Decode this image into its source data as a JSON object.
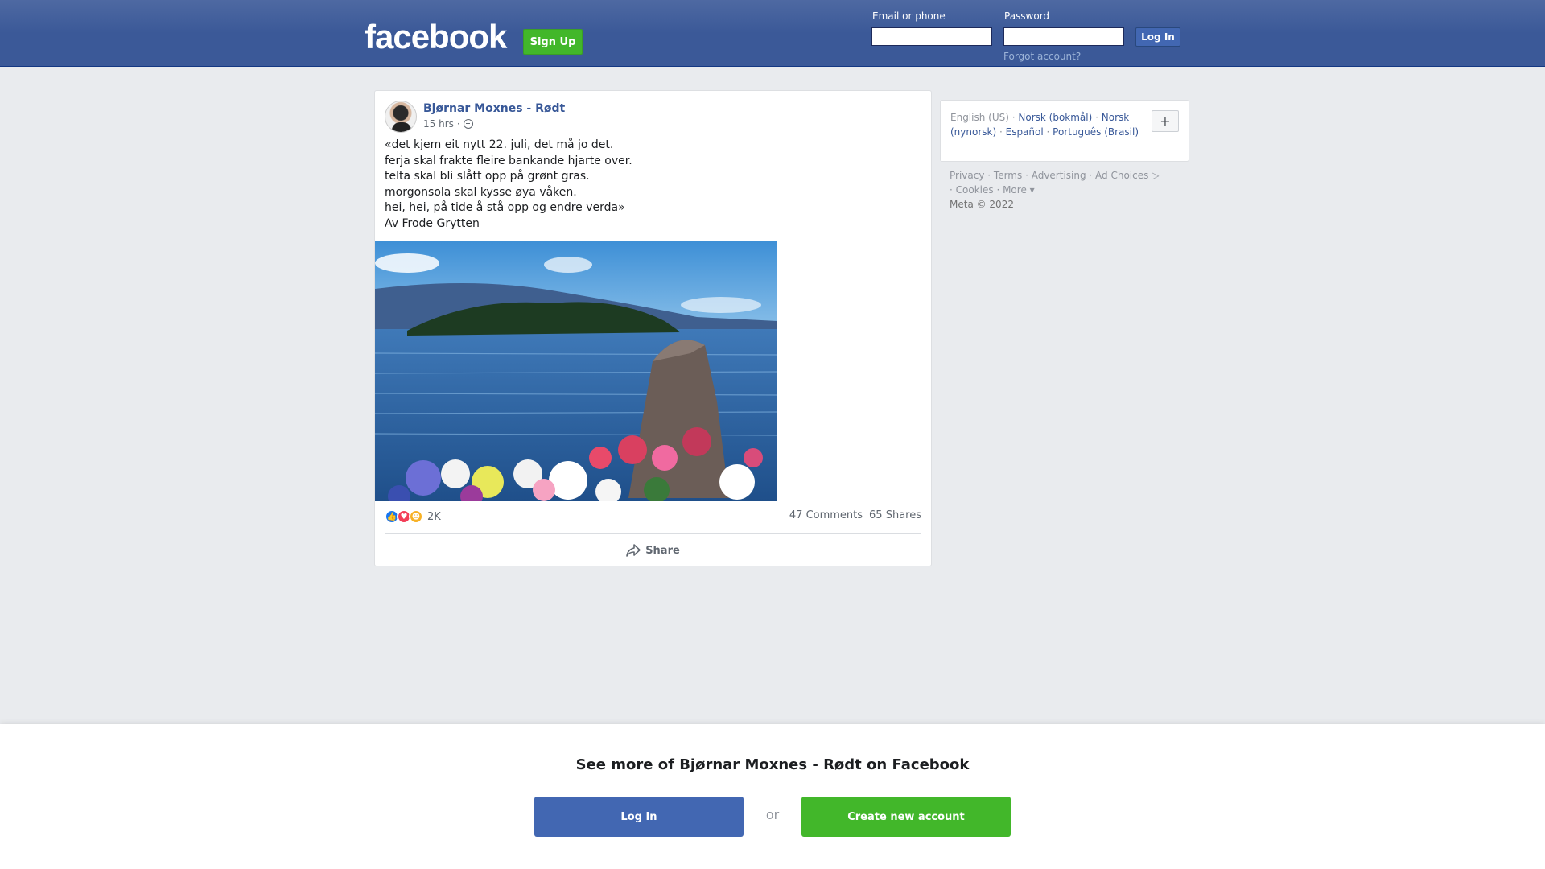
{
  "header": {
    "logo": "facebook",
    "signup_label": "Sign Up",
    "email_label": "Email or phone",
    "password_label": "Password",
    "login_label": "Log In",
    "forgot_label": "Forgot account?"
  },
  "post": {
    "author": "Bjørnar Moxnes - Rødt",
    "time": "15 hrs",
    "separator": "·",
    "lines": [
      "«det kjem eit nytt 22. juli, det må jo det.",
      "ferja skal frakte fleire bankande hjarte over.",
      "telta skal bli slått opp på grønt gras.",
      "morgonsola skal kysse øya våken.",
      "hei, hei, på tide å stå opp og endre verda»",
      "Av Frode Grytten"
    ],
    "reaction_count": "2K",
    "comments": "47 Comments",
    "shares": "65 Shares",
    "share_label": "Share"
  },
  "languages": {
    "current": "English (US)",
    "options": [
      "Norsk (bokmål)",
      "Norsk (nynorsk)",
      "Español",
      "Português (Brasil)"
    ],
    "add_icon": "plus-icon"
  },
  "footer": {
    "privacy": "Privacy",
    "terms": "Terms",
    "advertising": "Advertising",
    "ad_choices": "Ad Choices",
    "cookies": "Cookies",
    "more": "More",
    "copyright": "Meta © 2022"
  },
  "bottom": {
    "see_more": "See more of Bjørnar Moxnes - Rødt on Facebook",
    "login_label": "Log In",
    "or_label": "or",
    "create_label": "Create new account"
  },
  "colors": {
    "brand": "#3b5998",
    "link": "#385898",
    "green": "#42b72a"
  }
}
